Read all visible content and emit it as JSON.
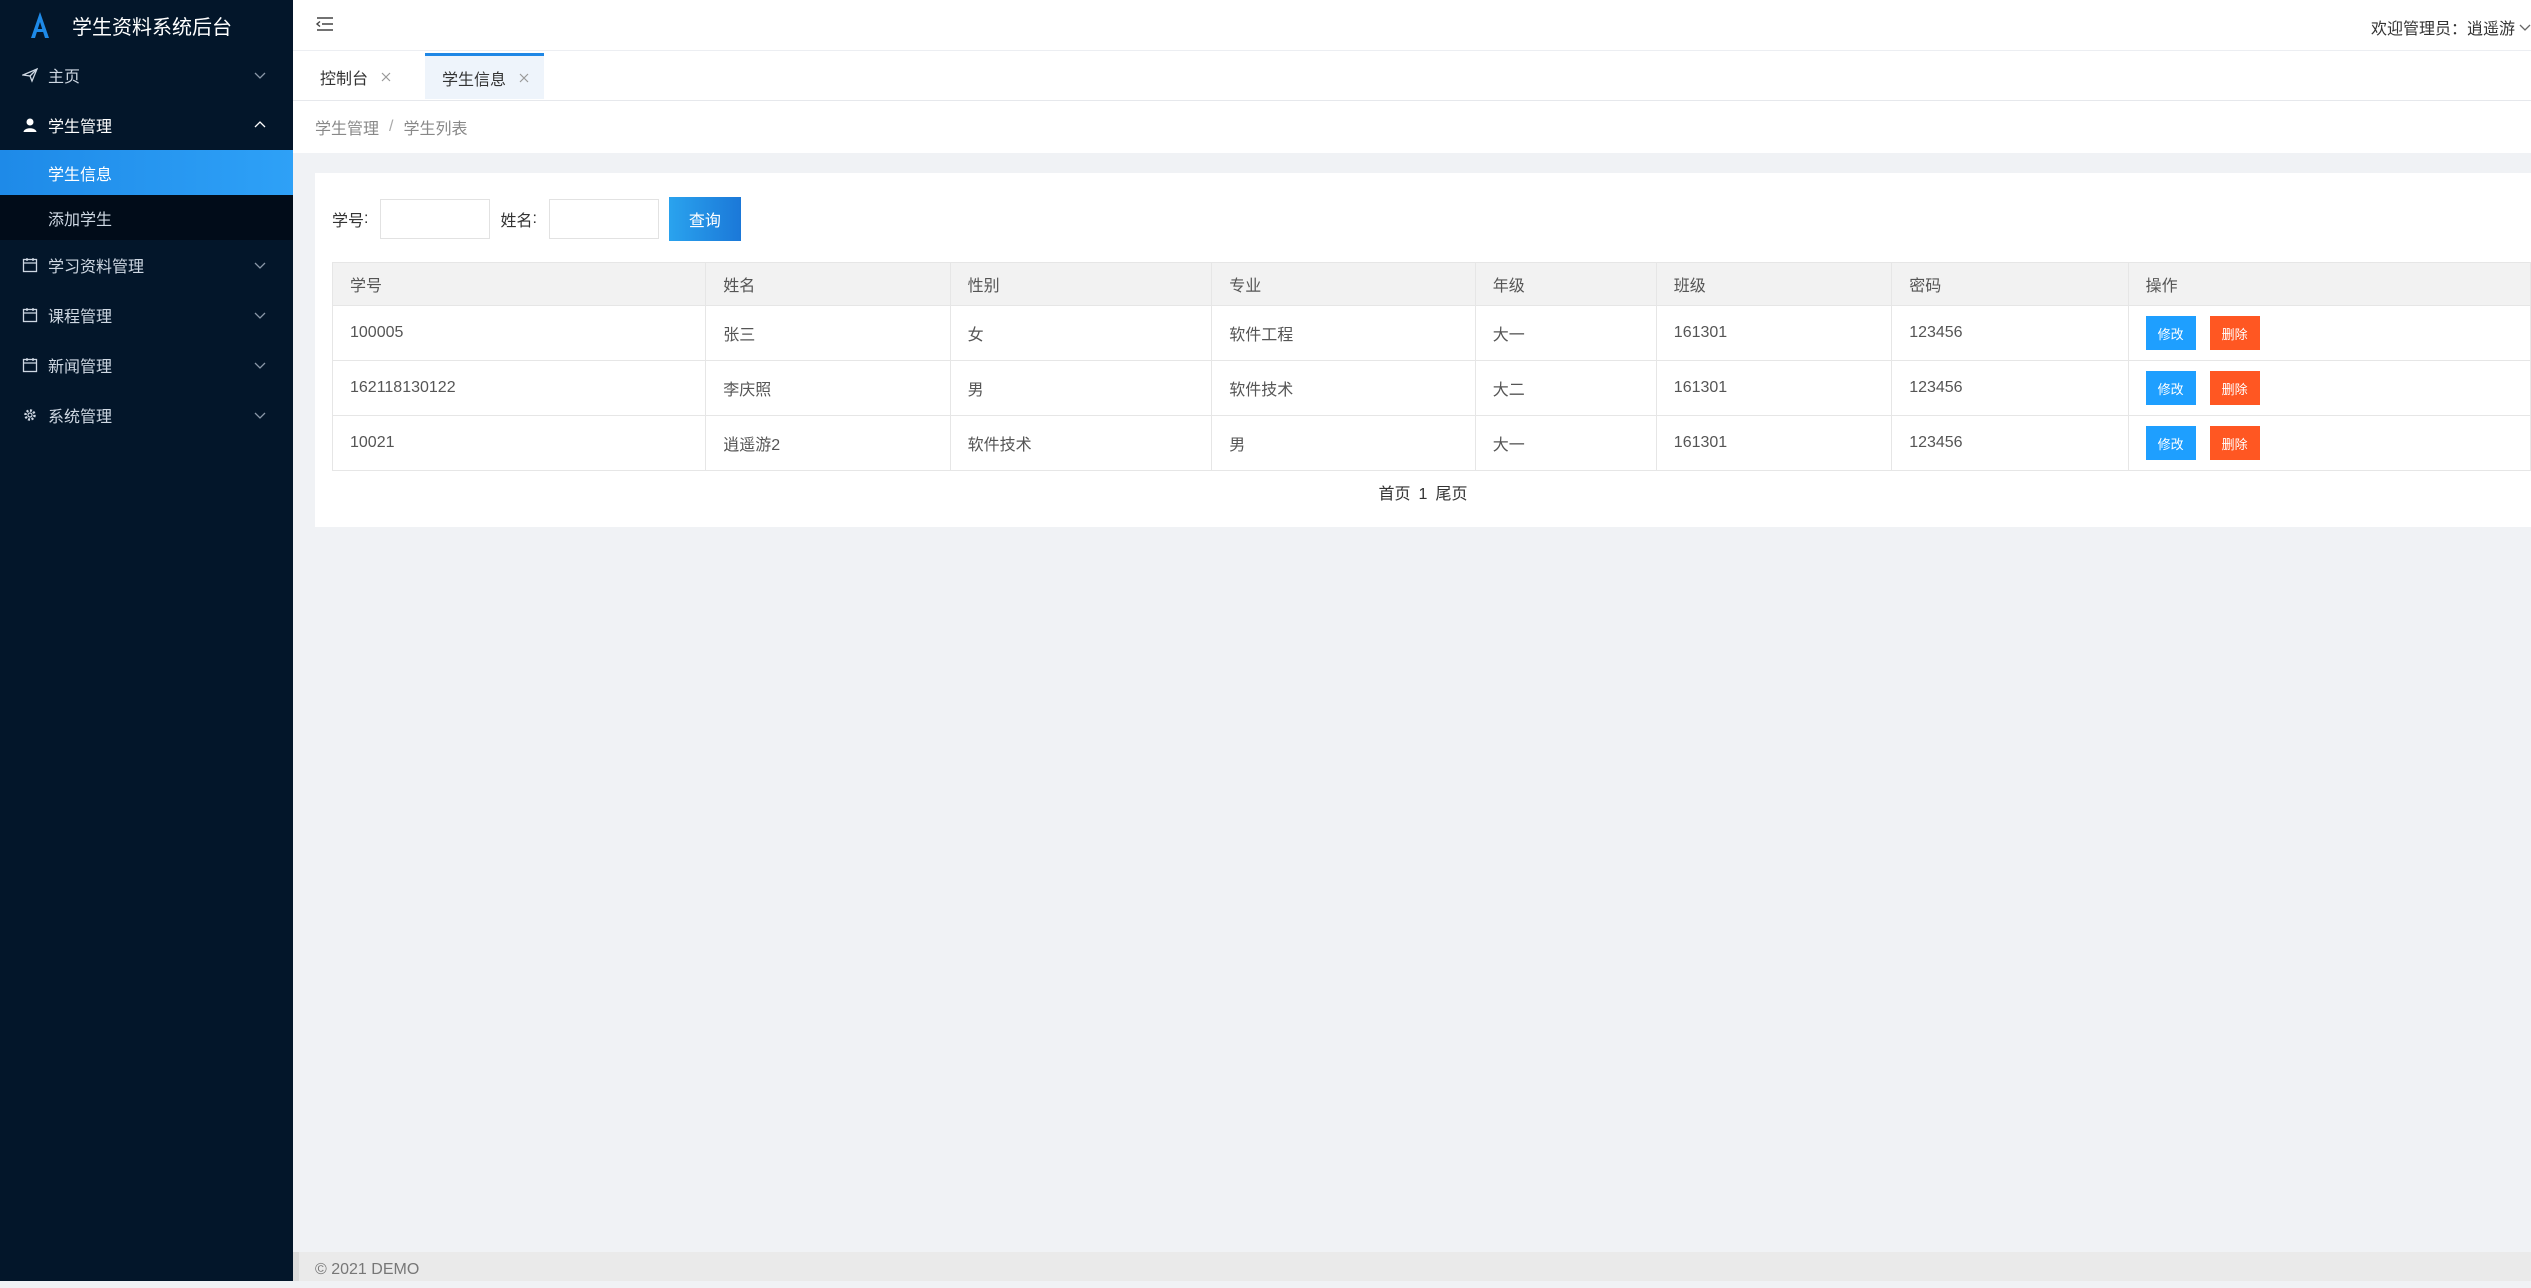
{
  "app": {
    "title": "学生资料系统后台"
  },
  "sidebar": {
    "items": [
      {
        "label": "主页"
      },
      {
        "label": "学生管理",
        "children": [
          {
            "label": "学生信息"
          },
          {
            "label": "添加学生"
          }
        ]
      },
      {
        "label": "学习资料管理"
      },
      {
        "label": "课程管理"
      },
      {
        "label": "新闻管理"
      },
      {
        "label": "系统管理"
      }
    ]
  },
  "header": {
    "user": "欢迎管理员：逍遥游"
  },
  "tabs": [
    {
      "label": "控制台"
    },
    {
      "label": "学生信息"
    }
  ],
  "breadcrumb": [
    "学生管理",
    "学生列表"
  ],
  "search": {
    "id_label": "学号",
    "name_label": "姓名",
    "id_value": "",
    "name_value": "",
    "query_label": "查询"
  },
  "table": {
    "headers": [
      "学号",
      "姓名",
      "性别",
      "专业",
      "年级",
      "班级",
      "密码",
      "操作"
    ],
    "rows": [
      [
        "100005",
        "张三",
        "女",
        "软件工程",
        "大一",
        "161301",
        "123456"
      ],
      [
        "162118130122",
        "李庆照",
        "男",
        "软件技术",
        "大二",
        "161301",
        "123456"
      ],
      [
        "10021",
        "逍遥游2",
        "软件技术",
        "男",
        "大一",
        "161301",
        "123456"
      ]
    ],
    "edit_label": "修改",
    "delete_label": "删除"
  },
  "pager": {
    "first": "首页",
    "page": "1",
    "last": "尾页"
  },
  "footer": {
    "text": "© 2021 DEMO"
  },
  "colors": {
    "sidebar_bg": "#03162a",
    "active": "#1e8ae8",
    "edit": "#1e9fff",
    "delete": "#ff5722"
  }
}
